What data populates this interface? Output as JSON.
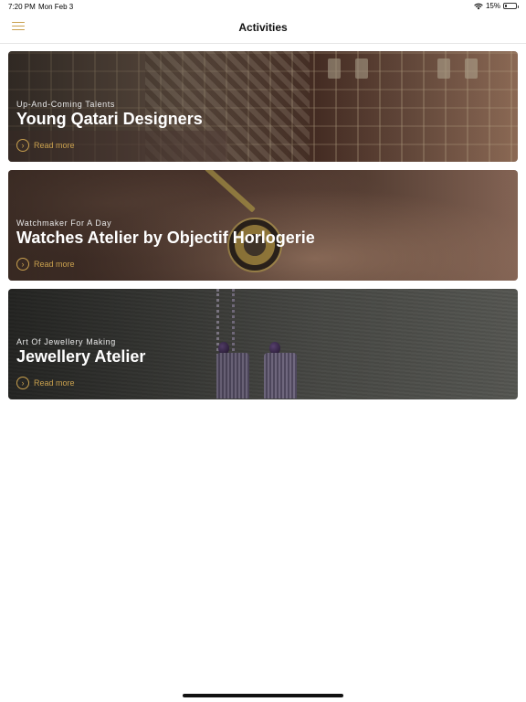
{
  "status_bar": {
    "time": "7:20 PM",
    "date": "Mon Feb 3",
    "battery": "15%",
    "battery_level": 0.15
  },
  "nav": {
    "title": "Activities",
    "menu_icon": "hamburger-menu-icon",
    "accent_color": "#c9a04e"
  },
  "activities": [
    {
      "subtitle": "Up-And-Coming Talents",
      "title": "Young Qatari Designers",
      "read_more": "Read more"
    },
    {
      "subtitle": "Watchmaker For A Day",
      "title": "Watches Atelier by Objectif Horlogerie",
      "read_more": "Read more"
    },
    {
      "subtitle": "Art Of Jewellery Making",
      "title": "Jewellery Atelier",
      "read_more": "Read more"
    }
  ]
}
